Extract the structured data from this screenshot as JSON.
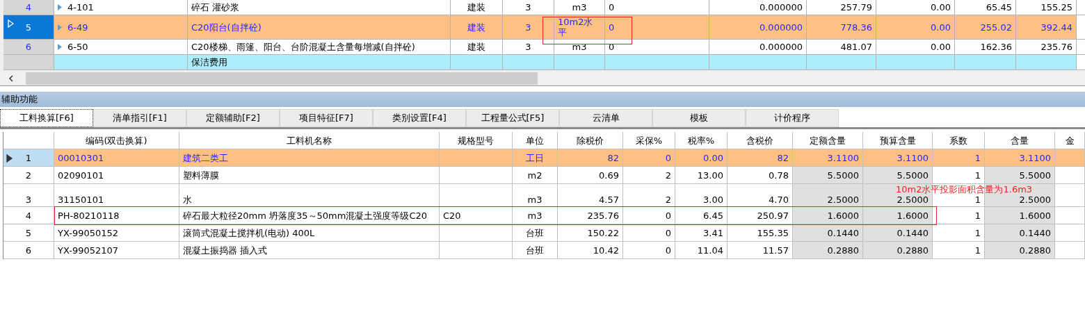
{
  "top_table": {
    "rows": [
      {
        "cells": [
          "4",
          "4-101",
          "碎石 灌砂浆",
          "建装",
          "3",
          "m3",
          "0",
          "0.000000",
          "257.79",
          "0.00",
          "65.45",
          "155.25"
        ],
        "selected": false,
        "kind": "item"
      },
      {
        "cells": [
          "5",
          "6-49",
          "C20阳台(自拌砼)",
          "建装",
          "3",
          "10m2水平",
          "0",
          "0.000000",
          "778.36",
          "0.00",
          "255.02",
          "392.44"
        ],
        "selected": true,
        "kind": "item"
      },
      {
        "cells": [
          "6",
          "6-50",
          "C20楼梯、雨篷、阳台、台阶混凝土含量每增减(自拌砼)",
          "建装",
          "3",
          "m3",
          "0",
          "0.000000",
          "481.07",
          "0.00",
          "162.36",
          "235.76"
        ],
        "selected": false,
        "kind": "item"
      },
      {
        "cells": [
          null,
          null,
          "保洁费用",
          null,
          null,
          null,
          null,
          null,
          null,
          null,
          null,
          null
        ],
        "selected": false,
        "kind": "fee"
      }
    ]
  },
  "panel": {
    "title": "辅助功能",
    "tabs": [
      {
        "label": "工料换算[F6]",
        "selected": true
      },
      {
        "label": "清单指引[F1]",
        "selected": false
      },
      {
        "label": "定额辅助[F2]",
        "selected": false
      },
      {
        "label": "项目特征[F7]",
        "selected": false
      },
      {
        "label": "类别设置[F4]",
        "selected": false
      },
      {
        "label": "工程量公式[F5]",
        "selected": false
      },
      {
        "label": "云清单",
        "selected": false
      },
      {
        "label": "模板",
        "selected": false
      },
      {
        "label": "计价程序",
        "selected": false
      }
    ],
    "table": {
      "columns": [
        null,
        "编码(双击换算)",
        "工料机名称",
        "规格型号",
        "单位",
        "除税价",
        "采保%",
        "税率%",
        "含税价",
        "定额含量",
        "预算含量",
        "系数",
        "含量",
        "金"
      ],
      "rows": [
        {
          "cells": [
            "1",
            "00010301",
            "建筑二类工",
            null,
            "工日",
            "82",
            "0",
            "0.00",
            "82",
            "3.1100",
            "3.1100",
            "1",
            "3.1100",
            null
          ],
          "selected": true
        },
        {
          "cells": [
            "2",
            "02090101",
            "塑料薄膜",
            null,
            "m2",
            "0.69",
            "2",
            "13.00",
            "0.78",
            "5.5000",
            "5.5000",
            "1",
            "5.5000",
            null
          ],
          "selected": false
        },
        {
          "cells": [
            "3",
            "31150101",
            "水",
            null,
            "m3",
            "4.57",
            "2",
            "3.00",
            "4.70",
            "2.5000",
            "2.5000",
            "1",
            "2.5000",
            null
          ],
          "selected": false,
          "note": "10m2水平投影面积含量为1.6m3"
        },
        {
          "cells": [
            "4",
            "PH-80210118",
            "碎石最大粒径20mm 坍落度35～50mm混凝土强度等级C20",
            "C20",
            "m3",
            "235.76",
            "0",
            "6.45",
            "250.97",
            "1.6000",
            "1.6000",
            "1",
            "1.6000",
            null
          ],
          "selected": false
        },
        {
          "cells": [
            "5",
            "YX-99050152",
            "滚筒式混凝土搅拌机(电动)  400L",
            null,
            "台班",
            "150.22",
            "0",
            "3.41",
            "155.35",
            "0.1440",
            "0.1440",
            "1",
            "0.1440",
            null
          ],
          "selected": false
        },
        {
          "cells": [
            "6",
            "YX-99052107",
            "混凝土振捣器 插入式",
            null,
            "台班",
            "10.42",
            "0",
            "11.04",
            "11.57",
            "0.2880",
            "0.2880",
            "1",
            "0.2880",
            null
          ],
          "selected": false
        }
      ]
    }
  }
}
